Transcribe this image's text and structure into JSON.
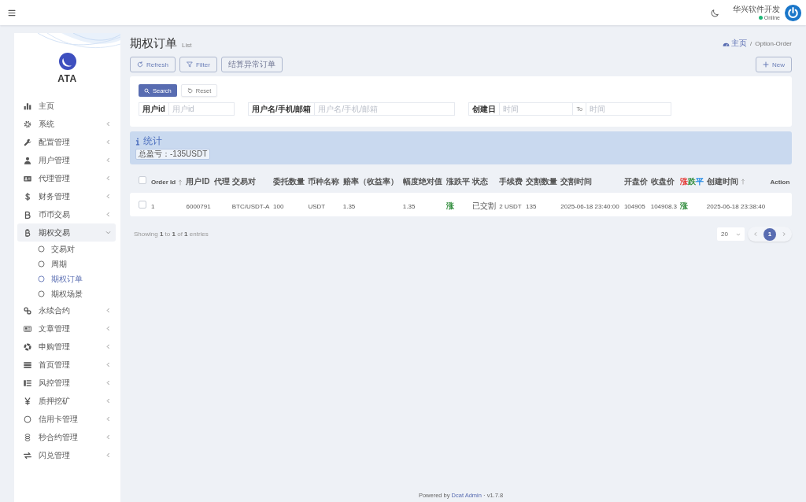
{
  "top_bar": {
    "user": {
      "name": "华兴软件开发",
      "status": "Online"
    }
  },
  "sidebar": {
    "brand": "ATA",
    "items": [
      {
        "label": "主页"
      },
      {
        "label": "系统",
        "expanded": false
      },
      {
        "label": "配置管理",
        "expanded": false
      },
      {
        "label": "用户管理",
        "expanded": false
      },
      {
        "label": "代理管理",
        "expanded": false
      },
      {
        "label": "财务管理",
        "expanded": false
      },
      {
        "label": "币币交易",
        "expanded": false
      },
      {
        "label": "期权交易",
        "expanded": true,
        "children": [
          {
            "label": "交易对",
            "selected": false
          },
          {
            "label": "周期",
            "selected": false
          },
          {
            "label": "期权订单",
            "selected": true
          },
          {
            "label": "期权场景",
            "selected": false
          }
        ]
      },
      {
        "label": "永续合约",
        "expanded": false
      },
      {
        "label": "文章管理",
        "expanded": false
      },
      {
        "label": "申购管理",
        "expanded": false
      },
      {
        "label": "首页管理",
        "expanded": false
      },
      {
        "label": "风控管理",
        "expanded": false
      },
      {
        "label": "质押挖矿",
        "expanded": false
      },
      {
        "label": "信用卡管理",
        "expanded": false
      },
      {
        "label": "秒合约管理",
        "expanded": false
      },
      {
        "label": "闪兑管理",
        "expanded": false
      }
    ]
  },
  "header": {
    "title": "期权订单",
    "subtitle": "List",
    "breadcrumb": {
      "items": [
        "主页",
        "Option-Order"
      ],
      "separator": "/"
    },
    "new_button": "New"
  },
  "toolbar": {
    "buttons": [
      {
        "label": "Refresh",
        "kind": "refresh"
      },
      {
        "label": "Filter",
        "kind": "filter"
      },
      {
        "label": "结算异常订单",
        "kind": "plain"
      }
    ]
  },
  "filter": {
    "search_button": "Search",
    "reset_button": "Reset",
    "fields": [
      {
        "kind": "text",
        "label": "用户id",
        "placeholder": "用户id"
      },
      {
        "kind": "text",
        "label": "用户名/手机/邮箱",
        "placeholder": "用户名/手机/邮箱"
      },
      {
        "kind": "range",
        "label": "创建日",
        "placeholder": "时间",
        "to_label": "To",
        "end_placeholder": "时间"
      }
    ]
  },
  "stats": {
    "title": "统计",
    "badge": "总盈亏：-135USDT"
  },
  "table": {
    "select_all": {
      "checked": false
    },
    "columns": [
      {
        "label": "Order Id",
        "sortable": true
      },
      {
        "label": "用户ID",
        "sortable": false
      },
      {
        "label": "代理",
        "sortable": false
      },
      {
        "label": "交易对",
        "sortable": false
      },
      {
        "label": "委托数量",
        "sortable": false
      },
      {
        "label": "币种名称",
        "sortable": false
      },
      {
        "label": "赔率（收益率）",
        "sortable": false
      },
      {
        "label": "幅度绝对值",
        "sortable": false
      },
      {
        "label": "涨跌平",
        "sortable": false
      },
      {
        "label": "状态",
        "sortable": false
      },
      {
        "label": "手续费",
        "sortable": false
      },
      {
        "label": "交割数量",
        "sortable": false
      },
      {
        "label": "交割时间",
        "sortable": false
      },
      {
        "label": "开盘价",
        "sortable": false
      },
      {
        "label": "收盘价",
        "sortable": false
      },
      {
        "parts": [
          {
            "text": "涨",
            "color": "#e53935"
          },
          {
            "text": "跌",
            "color": "#2e8b3a"
          },
          {
            "text": "平",
            "color": "#1e88e5"
          }
        ],
        "sortable": false
      },
      {
        "label": "创建时间",
        "sortable": true
      },
      {
        "label": "Action",
        "sortable": false
      }
    ],
    "rows": [
      {
        "checked": false,
        "cells": [
          "1",
          "6000791",
          null,
          "BTC/USDT-A",
          "100",
          "USDT",
          "1.35",
          "1.35",
          {
            "text": "涨",
            "color": "#2e8b3a"
          },
          "已交割",
          "2 USDT",
          "135",
          "2025-06-18 23:40:00",
          "104905",
          "104908.3",
          {
            "text": "涨",
            "color": "#2e8b3a"
          },
          "2025-06-18 23:38:40",
          null
        ]
      }
    ]
  },
  "pagination": {
    "summary": "Showing **1** to **1** of **1** entries",
    "per_page": "20",
    "pages": [
      {
        "label": "1",
        "selected": true
      }
    ]
  },
  "footer": {
    "text": "Powered by",
    "link": "Dcat Admin",
    "version": "· v1.7.8"
  }
}
